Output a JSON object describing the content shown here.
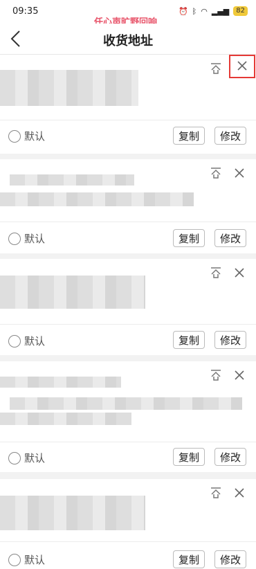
{
  "status": {
    "time": "09:35",
    "battery": "82"
  },
  "watermark": "任心声旷野回响",
  "header": {
    "title": "收货地址"
  },
  "cards": [
    {
      "default_label": "默认",
      "copy_label": "复制",
      "edit_label": "修改"
    },
    {
      "default_label": "默认",
      "copy_label": "复制",
      "edit_label": "修改"
    },
    {
      "default_label": "默认",
      "copy_label": "复制",
      "edit_label": "修改"
    },
    {
      "default_label": "默认",
      "copy_label": "复制",
      "edit_label": "修改"
    },
    {
      "default_label": "默认",
      "copy_label": "复制",
      "edit_label": "修改"
    }
  ]
}
